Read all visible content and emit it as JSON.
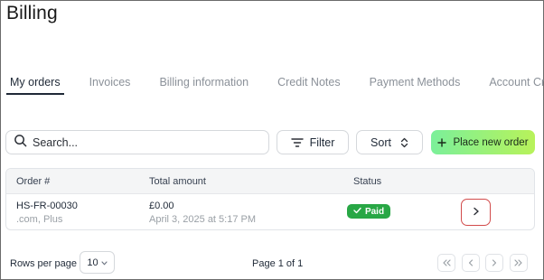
{
  "page": {
    "title": "Billing"
  },
  "tabs": [
    {
      "label": "My orders",
      "active": true
    },
    {
      "label": "Invoices"
    },
    {
      "label": "Billing information"
    },
    {
      "label": "Credit Notes"
    },
    {
      "label": "Payment Methods"
    },
    {
      "label": "Account Credit"
    }
  ],
  "toolbar": {
    "search_placeholder": "Search...",
    "filter_label": "Filter",
    "filter_icon": "filter-lines-icon",
    "sort_label": "Sort",
    "sort_icon": "chevron-up-down-icon",
    "new_order_label": "Place new order",
    "new_order_icon": "plus-icon",
    "new_order_gradient": [
      "#7bf09a",
      "#b8f25a"
    ]
  },
  "table": {
    "headers": [
      "Order #",
      "Total amount",
      "Status"
    ],
    "rows": [
      {
        "order_number": "HS-FR-00030",
        "order_detail": ".com, Plus",
        "total": "£0.00",
        "date": "April 3, 2025 at 5:17 PM",
        "status": "Paid",
        "status_color": "#28a745"
      }
    ]
  },
  "pagination": {
    "rows_per_page_label": "Rows per page",
    "rows_per_page_value": "10",
    "page_info": "Page 1 of 1"
  }
}
